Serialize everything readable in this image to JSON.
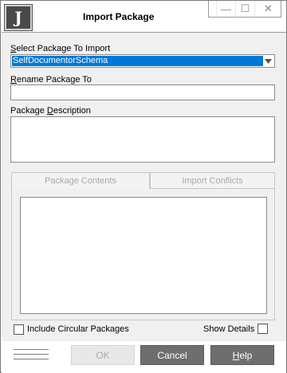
{
  "window": {
    "title": "Import Package",
    "logo_letter": "J",
    "controls": {
      "minimize": "—",
      "maximize": "☐",
      "close": "✕"
    }
  },
  "form": {
    "select_package_label_prefix": "S",
    "select_package_label_rest": "elect Package To Import",
    "select_package_value": "SelfDocumentorSchema",
    "rename_label_prefix": "R",
    "rename_label_rest": "ename Package To",
    "rename_value": "",
    "description_label_pre": "Package ",
    "description_label_u": "D",
    "description_label_rest": "escription",
    "description_value": ""
  },
  "tabs": [
    {
      "label": "Package Contents"
    },
    {
      "label": "Import Conflicts"
    }
  ],
  "options": {
    "include_circular_label": "Include Circular Packages",
    "include_circular_checked": false,
    "show_details_label": "Show Details",
    "show_details_checked": false
  },
  "buttons": {
    "ok": "OK",
    "cancel": "Cancel",
    "help_u": "H",
    "help_rest": "elp"
  }
}
